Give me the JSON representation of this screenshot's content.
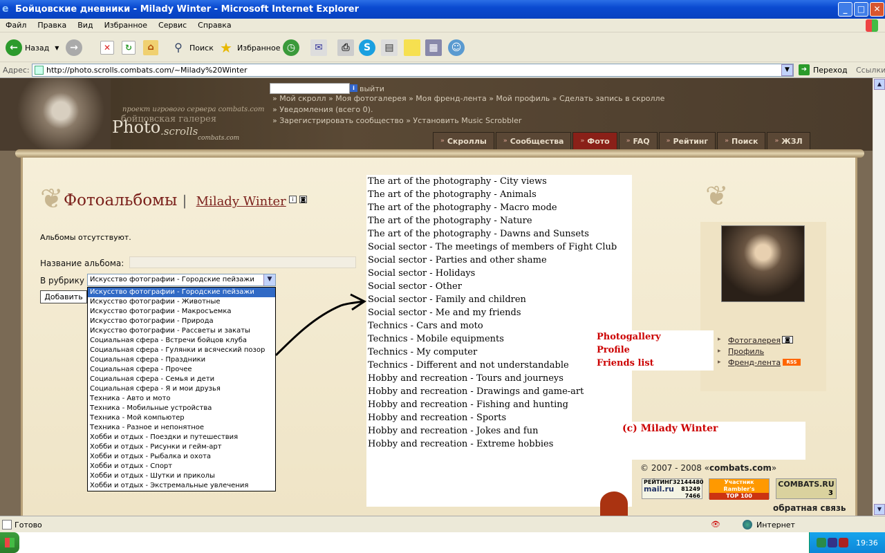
{
  "window": {
    "title": "Бойцовские дневники - Milady Winter - Microsoft Internet Explorer"
  },
  "menu": [
    "Файл",
    "Правка",
    "Вид",
    "Избранное",
    "Сервис",
    "Справка"
  ],
  "toolbar": {
    "back": "Назад",
    "search": "Поиск",
    "favorites": "Избранное"
  },
  "address": {
    "label": "Адрес:",
    "url": "http://photo.scrolls.combats.com/~Milady%20Winter",
    "go": "Переход",
    "links": "Ссылки"
  },
  "header": {
    "slogan": "проект игрового сервера combats.com",
    "gallery": "бойцовская галерея",
    "photo": "Photo",
    "scrolls": ".scrolls",
    "combats": "combats.com",
    "exit": "выйти",
    "links_row1": "» Мой скролл » Моя фотогалерея » Моя френд-лента » Мой профиль » Сделать запись в скролле",
    "links_row2": "» Уведомления (всего 0).",
    "links_row3": "» Зарегистрировать сообщество » Установить Music Scrobbler"
  },
  "nav": [
    {
      "label": "Скроллы",
      "active": false
    },
    {
      "label": "Сообщества",
      "active": false
    },
    {
      "label": "Фото",
      "active": true
    },
    {
      "label": "FAQ",
      "active": false
    },
    {
      "label": "Рейтинг",
      "active": false
    },
    {
      "label": "Поиск",
      "active": false
    },
    {
      "label": "ЖЗЛ",
      "active": false
    }
  ],
  "page": {
    "title": "Фотоальбомы",
    "sep": "|",
    "user": "Milady Winter",
    "no_albums": "Альбомы отсутствуют.",
    "album_name_label": "Название альбома:",
    "rubric_label": "В рубрику",
    "rubric_selected": "Искусство фотографии - Городские пейзажи",
    "add_button": "Добавить"
  },
  "rubric_options": [
    "Искусство фотографии - Городские пейзажи",
    "Искусство фотографии - Животные",
    "Искусство фотографии - Макросъемка",
    "Искусство фотографии - Природа",
    "Искусство фотографии - Рассветы и закаты",
    "Социальная сфера - Встречи бойцов клуба",
    "Социальная сфера - Гулянки и всяческий позор",
    "Социальная сфера - Праздники",
    "Социальная сфера - Прочее",
    "Социальная сфера - Семья и дети",
    "Социальная сфера - Я и мои друзья",
    "Техника - Авто и мото",
    "Техника - Мобильные устройства",
    "Техника - Мой компьютер",
    "Техника - Разное и непонятное",
    "Хобби и отдых - Поездки и путешествия",
    "Хобби и отдых - Рисунки и гейм-арт",
    "Хобби и отдых - Рыбалка и охота",
    "Хобби и отдых - Спорт",
    "Хобби и отдых - Шутки и приколы",
    "Хобби и отдых - Экстремальные увлечения"
  ],
  "translations": [
    "The art of the photography - City views",
    "The art of the photography - Animals",
    "The art of the photography - Macro mode",
    "The art of the photography - Nature",
    "The art of the photography - Dawns and Sunsets",
    "Social sector - The meetings of members of Fight Club",
    "Social sector - Parties and other shame",
    "Social sector - Holidays",
    "Social sector - Other",
    "Social sector - Family and children",
    "Social sector - Me and my friends",
    "Technics -  Cars and moto",
    "Technics - Mobile equipments",
    "Technics - My computer",
    "Technics - Different and not understandable",
    "Hobby and recreation - Tours and journeys",
    "Hobby and recreation - Drawings and game-art",
    "Hobby and recreation - Fishing and hunting",
    "Hobby and recreation - Sports",
    "Hobby and recreation - Jokes  and fun",
    "Hobby and recreation - Extreme hobbies"
  ],
  "profile": {
    "translated": [
      "Photogallery",
      "Profile",
      "Friends list"
    ],
    "links": [
      "Фотогалерея",
      "Профиль",
      "Френд-лента"
    ],
    "rss": "RSS"
  },
  "copyright_note": "(c) Milady Winter",
  "footer": {
    "years": "© 2007 - 2008 «",
    "site": "combats.com",
    "close": "»",
    "feedback": "обратная связь"
  },
  "counters": {
    "mailru": {
      "label": "РЕЙТИНГ",
      "id": "32144480",
      "brand": "mail.ru",
      "n1": "81249",
      "n2": "7466"
    },
    "rambler": {
      "line1": "Участник",
      "line2": "Rambler's",
      "line3": "TOP 100"
    },
    "combats": {
      "brand": "COMBATS.RU",
      "n": "3"
    }
  },
  "status": {
    "text": "Готово",
    "zone": "Интернет"
  },
  "clock": "19:36",
  "colors": {
    "accent": "#7a1f1a",
    "nav_active": "#8a2018",
    "note_red": "#cc0000"
  }
}
